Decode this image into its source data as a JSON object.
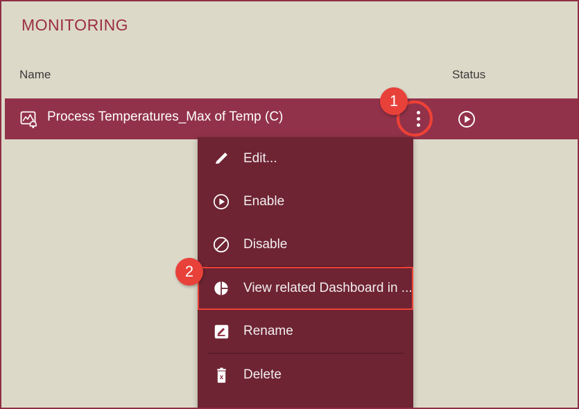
{
  "page": {
    "title": "MONITORING",
    "background_color": "#ddd9c9",
    "accent_color": "#92324a",
    "menu_color": "#6e2433",
    "highlight_color": "#ef4136"
  },
  "table": {
    "columns": [
      {
        "key": "name",
        "label": "Name"
      },
      {
        "key": "status",
        "label": "Status"
      }
    ],
    "rows": [
      {
        "icon": "alert-chart-bell-icon",
        "name": "Process Temperatures_Max of Temp (C)",
        "status_icon": "play-circle-icon",
        "selected": true,
        "row_menu_icon": "kebab-menu-icon"
      }
    ]
  },
  "context_menu": {
    "items": [
      {
        "icon": "pencil-icon",
        "label": "Edit...",
        "highlighted": false
      },
      {
        "icon": "play-circle-icon",
        "label": "Enable",
        "highlighted": false
      },
      {
        "icon": "block-icon",
        "label": "Disable",
        "highlighted": false
      },
      {
        "icon": "pie-chart-icon",
        "label": "View related Dashboard in ...",
        "highlighted": true
      },
      {
        "icon": "rename-square-icon",
        "label": "Rename",
        "highlighted": false
      },
      {
        "icon": "trash-x-icon",
        "label": "Delete",
        "highlighted": false
      }
    ]
  },
  "annotations": {
    "badges": [
      {
        "id": "step-1",
        "label": "1"
      },
      {
        "id": "step-2",
        "label": "2"
      }
    ]
  }
}
